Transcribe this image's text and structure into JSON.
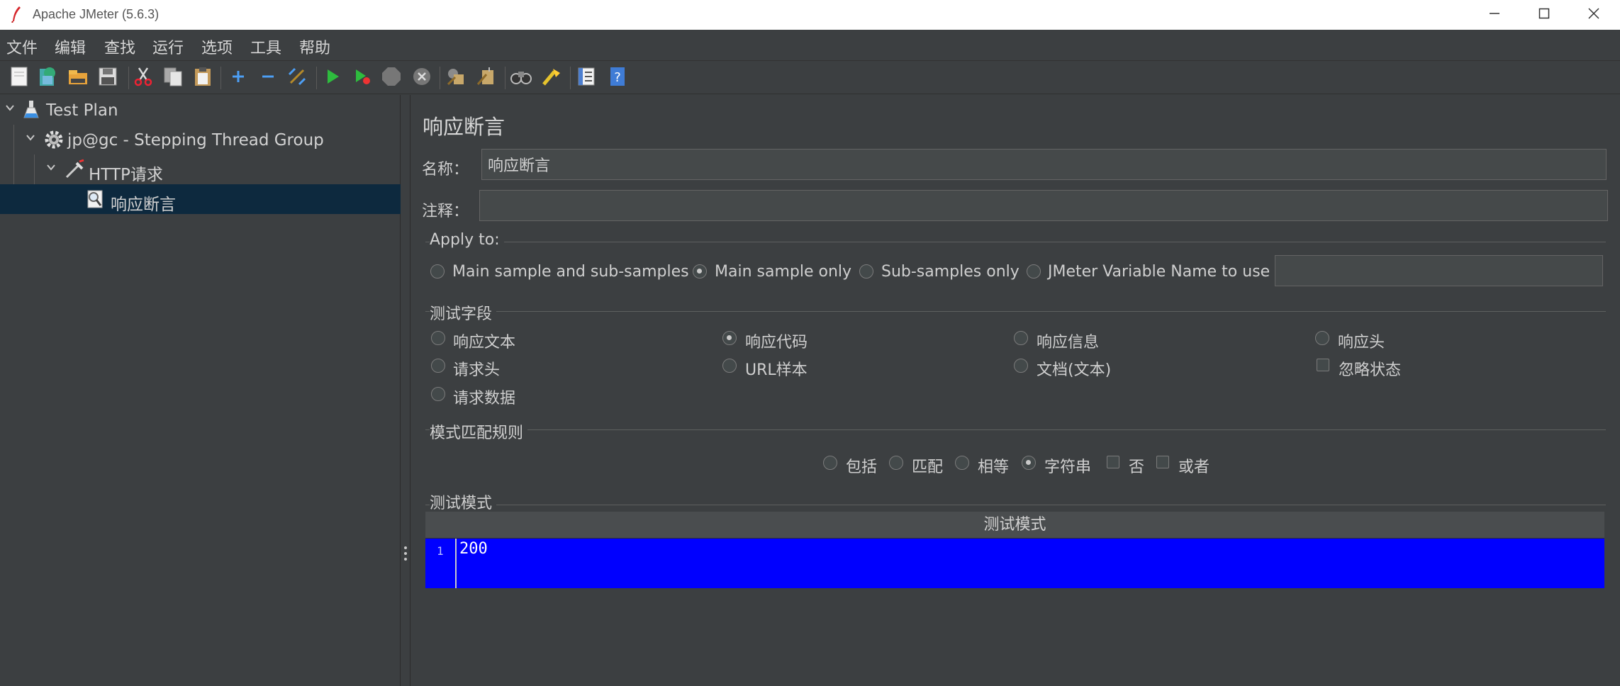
{
  "window": {
    "title": "Apache JMeter (5.6.3)"
  },
  "menu": [
    "文件",
    "编辑",
    "查找",
    "运行",
    "选项",
    "工具",
    "帮助"
  ],
  "toolbar": {
    "icons": [
      "new-icon",
      "templates-icon",
      "open-icon",
      "save-icon",
      "cut-icon",
      "copy-icon",
      "paste-icon",
      "expand-icon",
      "collapse-icon",
      "toggle-icon",
      "start-icon",
      "start-no-pause-icon",
      "stop-icon",
      "shutdown-icon",
      "clear-icon",
      "clear-all-icon",
      "search-icon",
      "reset-search-icon",
      "function-helper-icon",
      "help-icon"
    ]
  },
  "tree": {
    "items": [
      {
        "label": "Test Plan",
        "level": 0
      },
      {
        "label": "jp@gc - Stepping Thread Group",
        "level": 1
      },
      {
        "label": "HTTP请求",
        "level": 2
      },
      {
        "label": "响应断言",
        "level": 3,
        "selected": true
      }
    ]
  },
  "main": {
    "title": "响应断言",
    "name_label": "名称：",
    "name_value": "响应断言",
    "comment_label": "注释：",
    "comment_value": "",
    "apply_to": {
      "title": "Apply to:",
      "options": [
        "Main sample and sub-samples",
        "Main sample only",
        "Sub-samples only",
        "JMeter Variable Name to use"
      ],
      "selected": "Main sample only",
      "variable_value": ""
    },
    "test_field": {
      "title": "测试字段",
      "options": [
        "响应文本",
        "响应代码",
        "响应信息",
        "响应头",
        "请求头",
        "URL样本",
        "文档(文本)",
        "忽略状态",
        "请求数据"
      ],
      "selected": "响应代码",
      "ignore_status_checked": false
    },
    "pattern_rules": {
      "title": "模式匹配规则",
      "radios": [
        "包括",
        "匹配",
        "相等",
        "字符串"
      ],
      "selected": "字符串",
      "checks": [
        "否",
        "或者"
      ]
    },
    "test_patterns": {
      "title": "测试模式",
      "column_header": "测试模式",
      "line_number": "1",
      "value": "200"
    }
  },
  "colors": {
    "background": "#3c3f41",
    "selection": "#0d293e",
    "editor": "#0000ff"
  }
}
